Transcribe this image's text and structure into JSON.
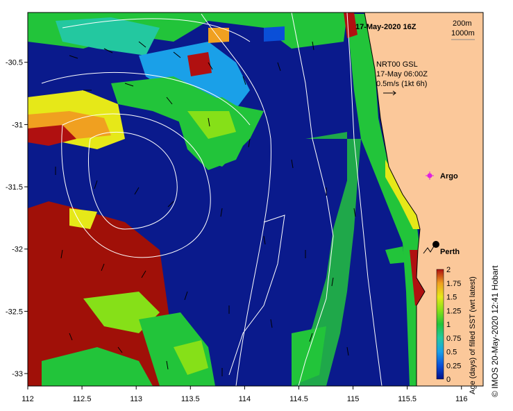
{
  "header": {
    "title": "17-May-2020 16Z",
    "depth_legend": [
      "200m",
      "1000m"
    ]
  },
  "currents_legend": {
    "source": "NRT00 GSL",
    "time": "17-May 06:00Z",
    "scale": "0.5m/s (1kt 6h)"
  },
  "places": [
    {
      "name": "Perth",
      "marker": "black-dot"
    },
    {
      "name": "Argo",
      "marker": "magenta-star"
    }
  ],
  "axes": {
    "x_ticks": [
      "112",
      "112.5",
      "113",
      "113.5",
      "114",
      "114.5",
      "115",
      "115.5",
      "116"
    ],
    "y_ticks": [
      "-30.5",
      "-31",
      "-31.5",
      "-32",
      "-32.5",
      "-33"
    ],
    "lon_range": [
      112,
      116.2
    ],
    "lat_range": [
      -33.1,
      -30.1
    ]
  },
  "colorbar": {
    "label": "Age (days) of filled SST (wrt latest)",
    "ticks": [
      "0",
      "0.25",
      "0.5",
      "0.75",
      "1",
      "1.25",
      "1.5",
      "1.75",
      "2"
    ],
    "colors": [
      "#00108a",
      "#0a4fd8",
      "#1aa0e8",
      "#23c8a0",
      "#22c43a",
      "#86e018",
      "#e6e818",
      "#f0a020",
      "#b01010"
    ]
  },
  "credit": "© IMOS 20-May-2020 12:41 Hobart",
  "colors": {
    "land": "#fbc89a",
    "deep_blue": "#0a1a8c",
    "old_red": "#a01008",
    "contour": "#ffffff"
  }
}
